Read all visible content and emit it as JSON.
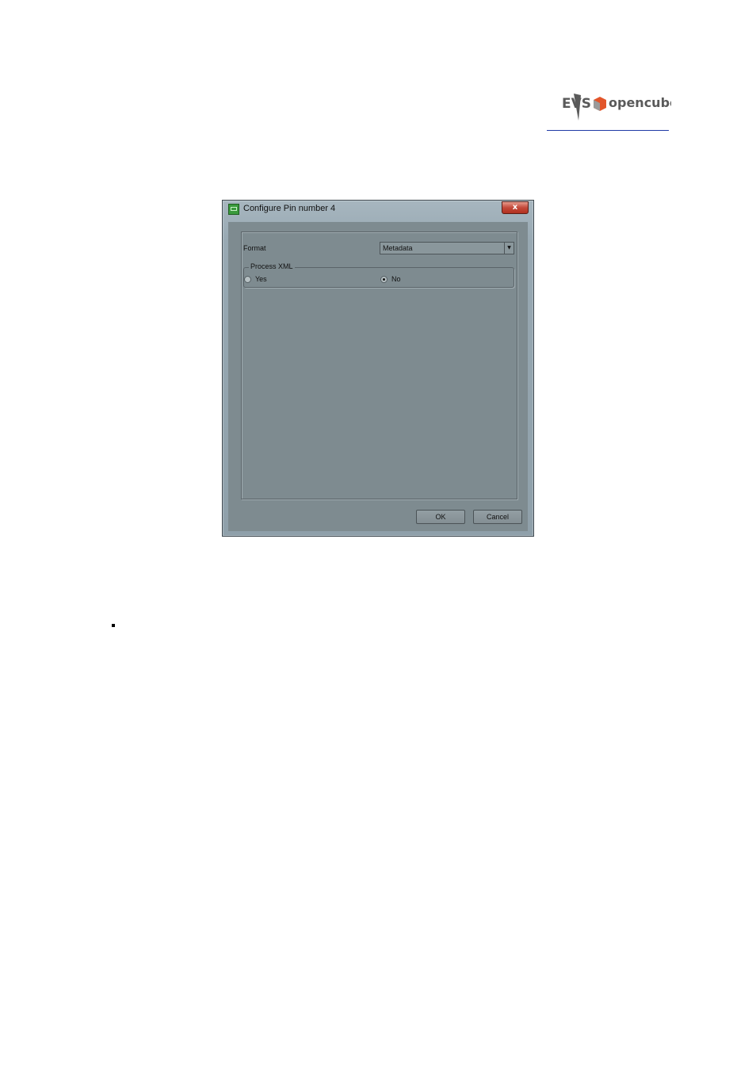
{
  "logo": {
    "brand_left": "EVS",
    "brand_right": "opencube"
  },
  "dialog": {
    "title": "Configure Pin number 4",
    "close_glyph": "x",
    "format_label": "Format",
    "format_value": "Metadata",
    "group_label": "Process XML",
    "options": [
      {
        "label": "Yes",
        "selected": false
      },
      {
        "label": "No",
        "selected": true
      }
    ],
    "ok_label": "OK",
    "cancel_label": "Cancel"
  },
  "colors": {
    "window_chrome": "#98a9b3",
    "client": "#7e8b90",
    "logo_orange": "#e2552a",
    "logo_grey": "#5a5a5a"
  }
}
